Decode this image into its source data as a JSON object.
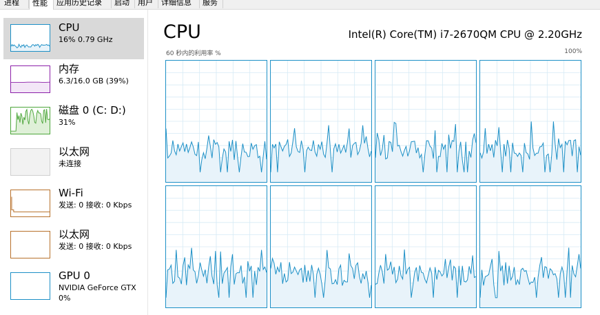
{
  "tabs": [
    "进程",
    "性能",
    "应用历史记录",
    "启动",
    "用户",
    "详细信息",
    "服务"
  ],
  "active_tab": 1,
  "sidebar": {
    "items": [
      {
        "title": "CPU",
        "sub": "16% 0.79 GHz",
        "sub2": "",
        "kind": "cpu",
        "color": "#1b8fc6",
        "selected": true
      },
      {
        "title": "内存",
        "sub": "6.3/16.0 GB (39%)",
        "sub2": "",
        "kind": "mem",
        "color": "#8b1fa8",
        "selected": false
      },
      {
        "title": "磁盘 0 (C: D:)",
        "sub": "31%",
        "sub2": "",
        "kind": "disk",
        "color": "#4ca63a",
        "selected": false
      },
      {
        "title": "以太网",
        "sub": "未连接",
        "sub2": "",
        "kind": "eth-off",
        "color": "#c0c0c0",
        "selected": false
      },
      {
        "title": "Wi-Fi",
        "sub": "发送: 0  接收: 0 Kbps",
        "sub2": "",
        "kind": "wifi",
        "color": "#b7702a",
        "selected": false
      },
      {
        "title": "以太网",
        "sub": "发送: 0  接收: 0 Kbps",
        "sub2": "",
        "kind": "eth",
        "color": "#b7702a",
        "selected": false
      },
      {
        "title": "GPU 0",
        "sub": "NVIDIA GeForce GTX",
        "sub2": "0%",
        "kind": "gpu",
        "color": "#1b8fc6",
        "selected": false
      }
    ]
  },
  "main": {
    "title": "CPU",
    "model": "Intel(R) Core(TM) i7-2670QM CPU @ 2.20GHz",
    "axis_left": "60 秒内的利用率 %",
    "axis_right": "100%"
  },
  "colors": {
    "cpu_line": "#1b8fc6",
    "cpu_fill": "#e8f3fa",
    "grid": "#d6eaf5"
  },
  "cores": 8
}
